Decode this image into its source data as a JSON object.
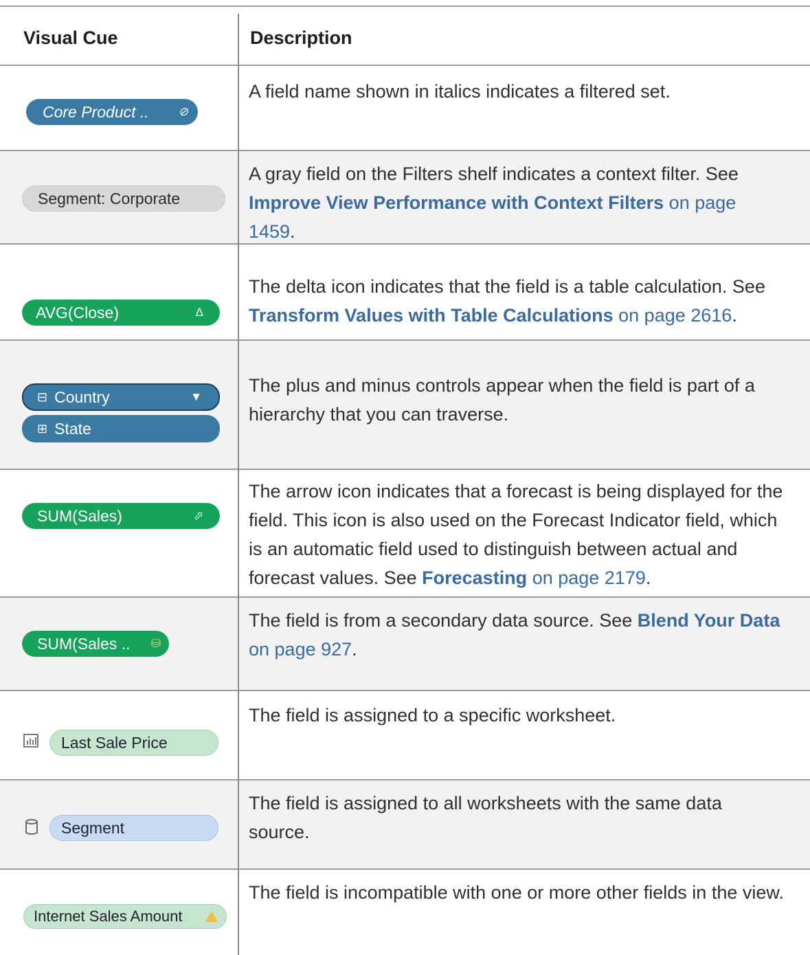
{
  "header": {
    "visual_cue": "Visual Cue",
    "description": "Description"
  },
  "rows": [
    {
      "pill": "Core Product ..",
      "pill_icon": "⊘",
      "desc": "A field name shown in italics indicates a filtered set."
    },
    {
      "pill": "Segment: Corporate",
      "desc_before": "A gray field on the Filters shelf indicates a context filter. See ",
      "link_bold": "Improve View Performance with Context Filters",
      "link_plain": " on page 1459",
      "desc_after": "."
    },
    {
      "pill": "AVG(Close)",
      "pill_icon": "Δ",
      "desc_before": "The delta icon indicates that the field is a table calculation. See ",
      "link_bold": "Transform Values with Table Calculations",
      "link_plain": " on page 2616",
      "desc_after": "."
    },
    {
      "pill": "Country",
      "pill_prefix": "⊟",
      "pill_icon": "▼",
      "pill2": "State",
      "pill2_prefix": "⊞",
      "desc": "The plus and minus controls appear when the field is part of a hierarchy that you can traverse."
    },
    {
      "pill": "SUM(Sales)",
      "pill_icon": "⬀",
      "desc_before": "The arrow icon indicates that a forecast is being displayed for the field. This icon is also used on the Forecast Indicator field, which is an automatic field used to distinguish between actual and forecast values. See ",
      "link_bold": "Forecasting",
      "link_plain": " on page 2179",
      "desc_after": "."
    },
    {
      "pill": "SUM(Sales ..",
      "pill_icon": "⛁",
      "desc_before": "The field is from a secondary data source. See ",
      "link_bold": "Blend Your Data",
      "link_plain": " on page 927",
      "desc_after": "."
    },
    {
      "pill": "Last Sale Price",
      "side_icon": "worksheet-icon",
      "desc": "The field is assigned to a specific worksheet."
    },
    {
      "pill": "Segment",
      "side_icon": "datasource-icon",
      "desc": "The field is assigned to all worksheets with the same data source."
    },
    {
      "pill": "Internet Sales Amount",
      "pill_icon": "!",
      "desc": "The field is incompatible with one or more other fields in the view."
    }
  ]
}
